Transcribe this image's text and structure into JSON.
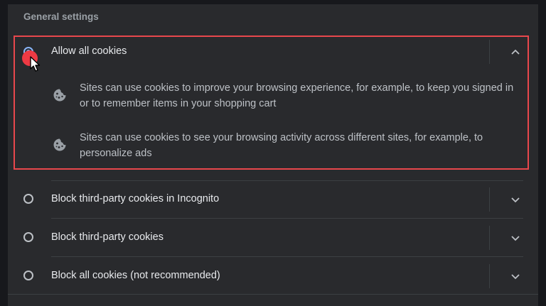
{
  "section": {
    "title": "General settings"
  },
  "options": [
    {
      "label": "Allow all cookies",
      "selected": true,
      "expanded": true,
      "details": [
        "Sites can use cookies to improve your browsing experience, for example, to keep you signed in or to remember items in your shopping cart",
        "Sites can use cookies to see your browsing activity across different sites, for example, to personalize ads"
      ]
    },
    {
      "label": "Block third-party cookies in Incognito",
      "selected": false,
      "expanded": false
    },
    {
      "label": "Block third-party cookies",
      "selected": false,
      "expanded": false
    },
    {
      "label": "Block all cookies (not recommended)",
      "selected": false,
      "expanded": false
    }
  ],
  "icons": {
    "detail": "cookie-icon",
    "expanded": "chevron-up-icon",
    "collapsed": "chevron-down-icon",
    "pointer": "mouse-cursor-icon"
  },
  "colors": {
    "background": "#292a2d",
    "accent": "#8ab4f8",
    "highlight_border": "#e8474c",
    "click_marker": "#ee3a44"
  }
}
